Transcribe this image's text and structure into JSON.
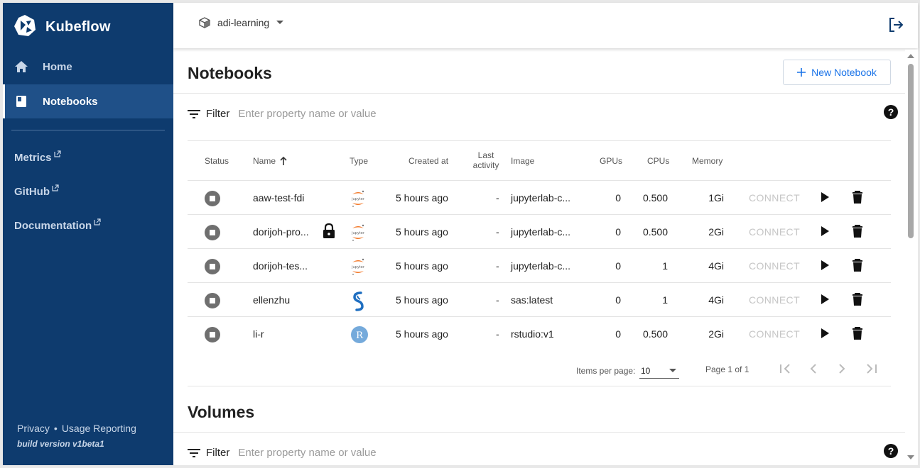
{
  "sidebar": {
    "brand": "Kubeflow",
    "items": [
      {
        "label": "Home"
      },
      {
        "label": "Notebooks"
      }
    ],
    "links": [
      {
        "label": "Metrics"
      },
      {
        "label": "GitHub"
      },
      {
        "label": "Documentation"
      }
    ],
    "footer": {
      "privacy": "Privacy",
      "dot": "•",
      "usage": "Usage Reporting",
      "build": "build version v1beta1"
    }
  },
  "topbar": {
    "namespace": "adi-learning"
  },
  "notebooks": {
    "title": "Notebooks",
    "new_button": "New Notebook",
    "filter_label": "Filter",
    "filter_placeholder": "Enter property name or value",
    "columns": {
      "status": "Status",
      "name": "Name",
      "type": "Type",
      "created": "Created at",
      "last_activity_1": "Last",
      "last_activity_2": "activity",
      "image": "Image",
      "gpus": "GPUs",
      "cpus": "CPUs",
      "memory": "Memory"
    },
    "rows": [
      {
        "name": "aaw-test-fdi",
        "type": "jupyter",
        "created": "5 hours ago",
        "last": "-",
        "image": "jupyterlab-c...",
        "gpus": "0",
        "cpus": "0.500",
        "memory": "1Gi",
        "connect": "CONNECT",
        "locked": false
      },
      {
        "name": "dorijoh-pro...",
        "type": "jupyter",
        "created": "5 hours ago",
        "last": "-",
        "image": "jupyterlab-c...",
        "gpus": "0",
        "cpus": "0.500",
        "memory": "2Gi",
        "connect": "CONNECT",
        "locked": true
      },
      {
        "name": "dorijoh-tes...",
        "type": "jupyter",
        "created": "5 hours ago",
        "last": "-",
        "image": "jupyterlab-c...",
        "gpus": "0",
        "cpus": "1",
        "memory": "4Gi",
        "connect": "CONNECT",
        "locked": false
      },
      {
        "name": "ellenzhu",
        "type": "sas",
        "created": "5 hours ago",
        "last": "-",
        "image": "sas:latest",
        "gpus": "0",
        "cpus": "1",
        "memory": "4Gi",
        "connect": "CONNECT",
        "locked": false
      },
      {
        "name": "li-r",
        "type": "rstudio",
        "created": "5 hours ago",
        "last": "-",
        "image": "rstudio:v1",
        "gpus": "0",
        "cpus": "0.500",
        "memory": "2Gi",
        "connect": "CONNECT",
        "locked": false
      }
    ],
    "paginator": {
      "items_per_page_label": "Items per page:",
      "items_per_page": "10",
      "range": "Page 1 of 1"
    }
  },
  "volumes": {
    "title": "Volumes",
    "filter_label": "Filter",
    "filter_placeholder": "Enter property name or value"
  },
  "colors": {
    "sidebar_bg": "#0e3b6e",
    "accent": "#1a73e8",
    "connect_disabled": "#c6c6c6"
  }
}
